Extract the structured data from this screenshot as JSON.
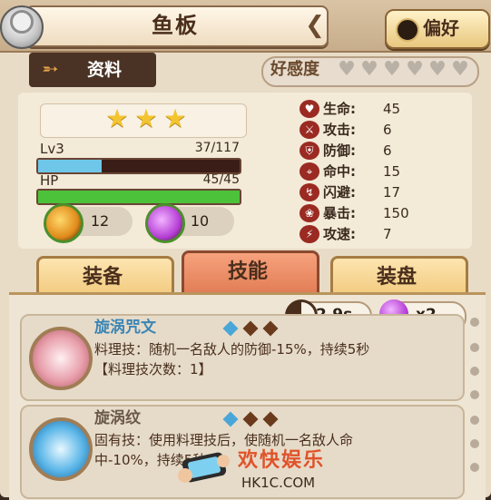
{
  "header": {
    "title": "鱼板",
    "preference_label": "偏好"
  },
  "info_tab": {
    "label": "资料"
  },
  "favorability": {
    "label": "好感度",
    "hearts_filled": 0,
    "hearts_total": 6
  },
  "character": {
    "stars": 3,
    "level_label": "Lv3",
    "exp_text": "37/117",
    "exp_fraction": 0.316,
    "hp_label": "HP",
    "hp_text": "45/45",
    "hp_fraction": 1.0,
    "item_a_count": "12",
    "item_b_count": "10"
  },
  "stats": [
    {
      "icon": "heart-icon",
      "label": "生命:",
      "value": "45"
    },
    {
      "icon": "sword-icon",
      "label": "攻击:",
      "value": "6"
    },
    {
      "icon": "shield-icon",
      "label": "防御:",
      "value": "6"
    },
    {
      "icon": "crosshair-icon",
      "label": "命中:",
      "value": "15"
    },
    {
      "icon": "dodge-icon",
      "label": "闪避:",
      "value": "17"
    },
    {
      "icon": "paw-icon",
      "label": "暴击:",
      "value": "150"
    },
    {
      "icon": "lightning-icon",
      "label": "攻速:",
      "value": "7"
    }
  ],
  "tabs": [
    {
      "label": "装备",
      "active": false
    },
    {
      "label": "技能",
      "active": true
    },
    {
      "label": "装盘",
      "active": false
    }
  ],
  "skill_meta": {
    "cooldown": "2.9s",
    "multiplier": "x2"
  },
  "skills": [
    {
      "name": "旋涡咒文",
      "line1": "料理技：随机一名敌人的防御-15%，持续5秒",
      "line2": "【料理技次数：1】"
    },
    {
      "name": "旋涡纹",
      "line1": "固有技：使用料理技后，使随机一名敌人命",
      "line2": "中-10%，持续5秒"
    }
  ],
  "watermark": {
    "title": "欢快娱乐",
    "site": "HK1C.COM"
  },
  "colors": {
    "exp_bar": "#6ec6e8",
    "hp_bar": "#4cc23a",
    "accent_red": "#9a2a22",
    "skill_name": "#3b86b6"
  }
}
